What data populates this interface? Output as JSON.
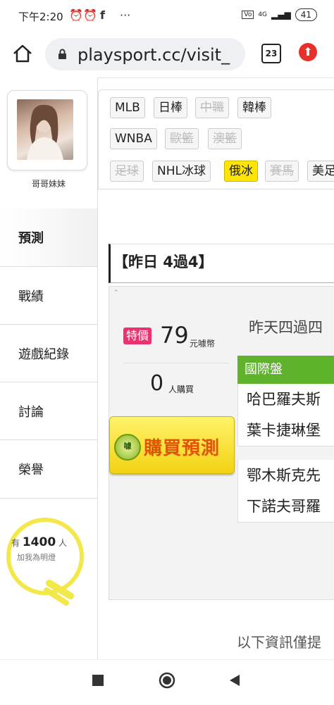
{
  "status_bar": {
    "time": "下午2:20",
    "network": "4G",
    "battery": "41"
  },
  "browser": {
    "url": "playsport.cc/visit_",
    "tab_count": "23"
  },
  "sidebar": {
    "user_name": "哥哥妹妹",
    "nav": [
      {
        "label": "預測",
        "active": true
      },
      {
        "label": "戰績"
      },
      {
        "label": "遊戲紀錄"
      },
      {
        "label": "討論"
      },
      {
        "label": "榮譽"
      }
    ],
    "light": {
      "prefix": "有",
      "count": "1400",
      "suffix": "人",
      "cta": "加我為明燈"
    }
  },
  "tags": [
    {
      "label": "MLB",
      "state": "normal"
    },
    {
      "label": "日棒",
      "state": "normal"
    },
    {
      "label": "中職",
      "state": "disabled"
    },
    {
      "label": "韓棒",
      "state": "normal"
    },
    {
      "label": "WNBA",
      "state": "normal"
    },
    {
      "label": "歐籃",
      "state": "disabled"
    },
    {
      "label": "澳籃",
      "state": "disabled"
    },
    {
      "label": "足球",
      "state": "disabled"
    },
    {
      "label": "NHL冰球",
      "state": "normal"
    },
    {
      "label": "俄冰",
      "state": "selected"
    },
    {
      "label": "賽馬",
      "state": "disabled"
    },
    {
      "label": "美足",
      "state": "normal"
    }
  ],
  "headline": "【昨日 4過4】",
  "offer": {
    "badge": "特價",
    "price": "79",
    "price_unit": "元噱幣",
    "buyers": "0",
    "buyers_unit": "人購買",
    "coin_icon_text": "噱",
    "buy_button": "購買預測"
  },
  "summary": "昨天四過四",
  "intl": {
    "header": "國際盤",
    "matches": [
      {
        "line1": "哈巴羅夫斯",
        "line2": "葉卡捷琳堡"
      },
      {
        "line1": "鄂木斯克先",
        "line2": "下諾夫哥羅"
      }
    ]
  },
  "footer_note": "以下資訊僅提"
}
